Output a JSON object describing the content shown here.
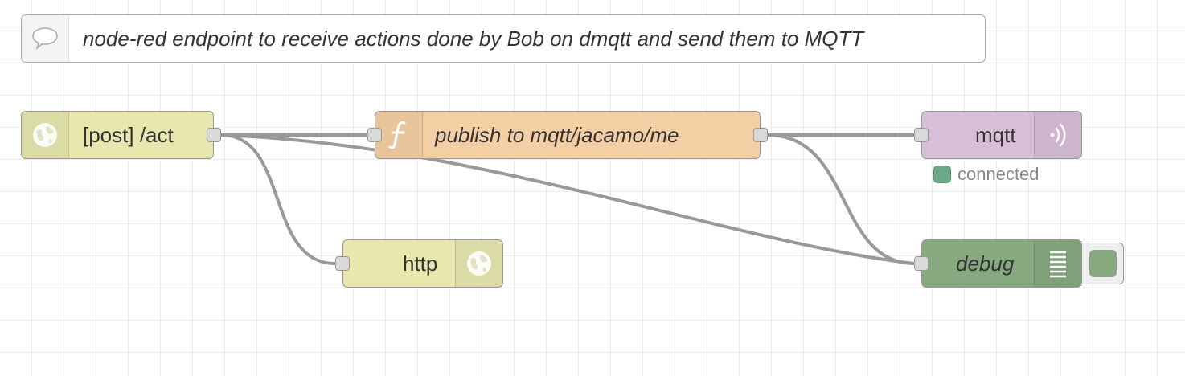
{
  "comment": {
    "text": "node-red endpoint to receive actions done by Bob on dmqtt and send them to MQTT",
    "icon": "comment-icon"
  },
  "nodes": {
    "http_in": {
      "label": "[post] /act",
      "color": "#e7e7ae",
      "icon": "globe-icon"
    },
    "function": {
      "label": "publish to mqtt/jacamo/me",
      "color": "#f5cfa4",
      "icon": "function-icon"
    },
    "mqtt_out": {
      "label": "mqtt",
      "color": "#d8bfd8",
      "icon": "mqtt-icon",
      "status": "connected",
      "status_color": "#6aa887"
    },
    "http_response": {
      "label": "http",
      "color": "#e7e7ae",
      "icon": "globe-icon"
    },
    "debug": {
      "label": "debug",
      "color": "#87a980",
      "icon": "debug-list-icon"
    }
  }
}
